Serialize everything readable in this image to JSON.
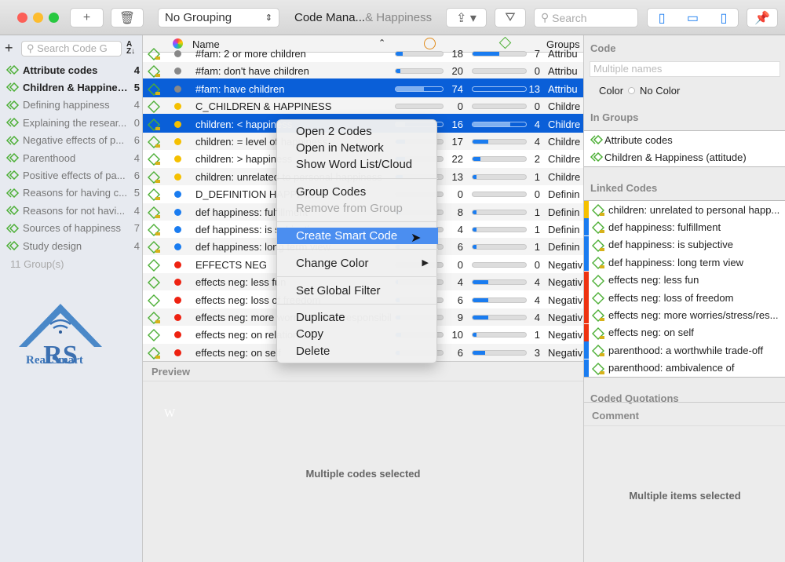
{
  "toolbar": {
    "grouping": "No Grouping",
    "title_main": "Code Mana...",
    "title_rest": "& Happiness",
    "search_placeholder": "Search"
  },
  "sidebar": {
    "search_placeholder": "Search Code G",
    "footer": "11 Group(s)",
    "items": [
      {
        "label": "Attribute codes",
        "count": "4",
        "bold": true
      },
      {
        "label": "Children & Happines...",
        "count": "5",
        "bold": true
      },
      {
        "label": "Defining happiness",
        "count": "4"
      },
      {
        "label": "Explaining the resear...",
        "count": "0"
      },
      {
        "label": "Negative effects of p...",
        "count": "6"
      },
      {
        "label": "Parenthood",
        "count": "4"
      },
      {
        "label": "Positive effects of pa...",
        "count": "6"
      },
      {
        "label": "Reasons for having c...",
        "count": "5"
      },
      {
        "label": "Reasons for not havi...",
        "count": "4"
      },
      {
        "label": "Sources of happiness",
        "count": "7"
      },
      {
        "label": "Study design",
        "count": "4"
      }
    ],
    "logo_text": "Real Smart"
  },
  "table": {
    "headers": {
      "name": "Name",
      "groups": "Groups"
    },
    "rows": [
      {
        "name": "#fam: 2 or more children",
        "dot": "#888888",
        "q": "18",
        "l": "7",
        "group": "Attribu",
        "qf": 0.15,
        "lf": 0.5
      },
      {
        "name": "#fam: don't have children",
        "dot": "#888888",
        "q": "20",
        "l": "0",
        "group": "Attribu",
        "qf": 0.1,
        "lf": 0
      },
      {
        "name": "#fam: have children",
        "dot": "#888888",
        "q": "74",
        "l": "13",
        "group": "Attribu",
        "qf": 0.6,
        "lf": 0,
        "sel": true
      },
      {
        "name": "C_CHILDREN & HAPPINESS",
        "dot": "#f5c000",
        "q": "0",
        "l": "0",
        "group": "Childre",
        "qf": 0,
        "lf": 0,
        "plain": true
      },
      {
        "name": "children: < happiness",
        "dot": "#f5c000",
        "q": "16",
        "l": "4",
        "group": "Childre",
        "qf": 0.2,
        "lf": 0.7,
        "sel": true
      },
      {
        "name": "children: = level of happiness",
        "dot": "#f5c000",
        "q": "17",
        "l": "4",
        "group": "Childre",
        "qf": 0.2,
        "lf": 0.3
      },
      {
        "name": "children: > happiness",
        "dot": "#f5c000",
        "q": "22",
        "l": "2",
        "group": "Childre",
        "qf": 0.2,
        "lf": 0.15
      },
      {
        "name": "children: unrelated to personal happiness",
        "dot": "#f5c000",
        "q": "13",
        "l": "1",
        "group": "Childre",
        "qf": 0.15,
        "lf": 0.07
      },
      {
        "name": "D_DEFINITION HAPPINESS",
        "dot": "#1a7cf0",
        "q": "0",
        "l": "0",
        "group": "Definin",
        "qf": 0,
        "lf": 0
      },
      {
        "name": "def happiness: fulfillment",
        "dot": "#1a7cf0",
        "q": "8",
        "l": "1",
        "group": "Definin",
        "qf": 0.1,
        "lf": 0.07
      },
      {
        "name": "def happiness: is subjective",
        "dot": "#1a7cf0",
        "q": "4",
        "l": "1",
        "group": "Definin",
        "qf": 0.05,
        "lf": 0.07
      },
      {
        "name": "def happiness: long term view",
        "dot": "#1a7cf0",
        "q": "6",
        "l": "1",
        "group": "Definin",
        "qf": 0.08,
        "lf": 0.07
      },
      {
        "name": "EFFECTS NEG",
        "dot": "#ee2211",
        "q": "0",
        "l": "0",
        "group": "Negativ",
        "qf": 0,
        "lf": 0,
        "plain": true
      },
      {
        "name": "effects neg: less fun",
        "dot": "#ee2211",
        "q": "4",
        "l": "4",
        "group": "Negativ",
        "qf": 0.05,
        "lf": 0.3,
        "plain": true
      },
      {
        "name": "effects neg: loss of freedom",
        "dot": "#ee2211",
        "q": "6",
        "l": "4",
        "group": "Negativ",
        "qf": 0.08,
        "lf": 0.3,
        "plain": true
      },
      {
        "name": "effects neg: more worries/stress/responsibility",
        "dot": "#ee2211",
        "q": "9",
        "l": "4",
        "group": "Negativ",
        "qf": 0.1,
        "lf": 0.3
      },
      {
        "name": "effects neg: on relationship",
        "dot": "#ee2211",
        "q": "10",
        "l": "1",
        "group": "Negativ",
        "qf": 0.12,
        "lf": 0.07,
        "plain": true
      },
      {
        "name": "effects neg: on self",
        "dot": "#ee2211",
        "q": "6",
        "l": "3",
        "group": "Negativ",
        "qf": 0.08,
        "lf": 0.23
      }
    ]
  },
  "preview": {
    "title": "Preview",
    "message": "Multiple codes selected",
    "letter": "W"
  },
  "inspector": {
    "code_title": "Code",
    "name_placeholder": "Multiple names",
    "color_label": "Color",
    "color_value": "No Color",
    "in_groups_title": "In Groups",
    "groups": [
      "Attribute codes",
      "Children & Happiness (attitude)"
    ],
    "linked_title": "Linked Codes",
    "linked": [
      {
        "label": "children: unrelated to personal happ...",
        "color": "#f5c000"
      },
      {
        "label": "def happiness: fulfillment",
        "color": "#1a7cf0"
      },
      {
        "label": "def happiness: is subjective",
        "color": "#1a7cf0"
      },
      {
        "label": "def happiness: long term view",
        "color": "#1a7cf0"
      },
      {
        "label": "effects neg: less fun",
        "color": "#ee3311",
        "plain": true
      },
      {
        "label": "effects neg: loss of freedom",
        "color": "#ee3311",
        "plain": true
      },
      {
        "label": "effects neg: more worries/stress/res...",
        "color": "#ee3311"
      },
      {
        "label": "effects neg: on self",
        "color": "#ee3311"
      },
      {
        "label": "parenthood: a worthwhile trade-off",
        "color": "#1a7cf0"
      },
      {
        "label": "parenthood: ambivalence of",
        "color": "#1a7cf0"
      }
    ],
    "coded_title": "Coded Quotations",
    "comment_title": "Comment",
    "comment_message": "Multiple items selected"
  },
  "context_menu": {
    "items": [
      "Open 2 Codes",
      "Open in Network",
      "Show Word List/Cloud",
      "Group Codes",
      "Remove from Group",
      "Create Smart Code",
      "Change Color",
      "Set Global Filter",
      "Duplicate",
      "Copy",
      "Delete"
    ]
  }
}
